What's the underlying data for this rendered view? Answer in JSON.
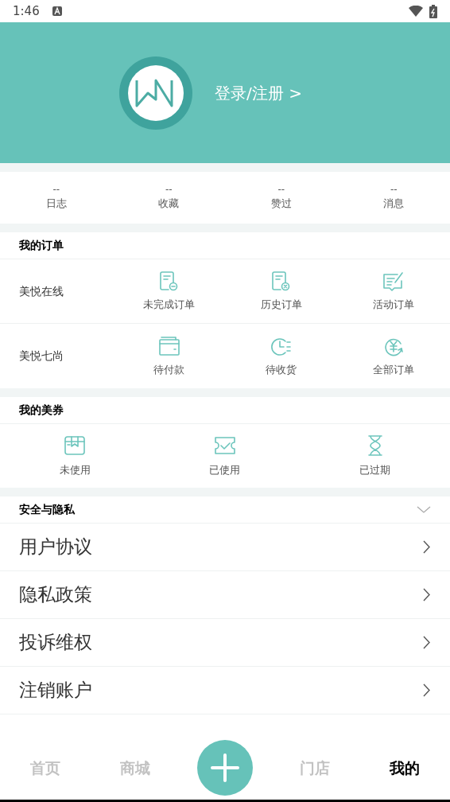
{
  "status_bar": {
    "time": "1:46"
  },
  "profile": {
    "login": "登录/注册 >"
  },
  "stats": [
    {
      "value": "--",
      "label": "日志"
    },
    {
      "value": "--",
      "label": "收藏"
    },
    {
      "value": "--",
      "label": "赞过"
    },
    {
      "value": "--",
      "label": "消息"
    }
  ],
  "orders": {
    "title": "我的订单",
    "groups": [
      {
        "name": "美悦在线",
        "items": [
          {
            "kind": "doc-minus",
            "label": "未完成订单"
          },
          {
            "kind": "doc-x",
            "label": "历史订单"
          },
          {
            "kind": "note-edit",
            "label": "活动订单"
          }
        ]
      },
      {
        "name": "美悦七尚",
        "items": [
          {
            "kind": "wallet",
            "label": "待付款"
          },
          {
            "kind": "clock",
            "label": "待收货"
          },
          {
            "kind": "yen",
            "label": "全部订单"
          }
        ]
      }
    ]
  },
  "coupons": {
    "title": "我的美券",
    "items": [
      {
        "kind": "box",
        "label": "未使用"
      },
      {
        "kind": "ticket",
        "label": "已使用"
      },
      {
        "kind": "hourglass",
        "label": "已过期"
      }
    ]
  },
  "security": {
    "title": "安全与隐私",
    "items": [
      "用户协议",
      "隐私政策",
      "投诉维权",
      "注销账户"
    ]
  },
  "tab_bar": [
    {
      "label": "首页",
      "selected": false
    },
    {
      "label": "商城",
      "selected": false
    },
    {
      "kind": "add"
    },
    {
      "label": "门店",
      "selected": false
    },
    {
      "label": "我的",
      "selected": true
    }
  ]
}
